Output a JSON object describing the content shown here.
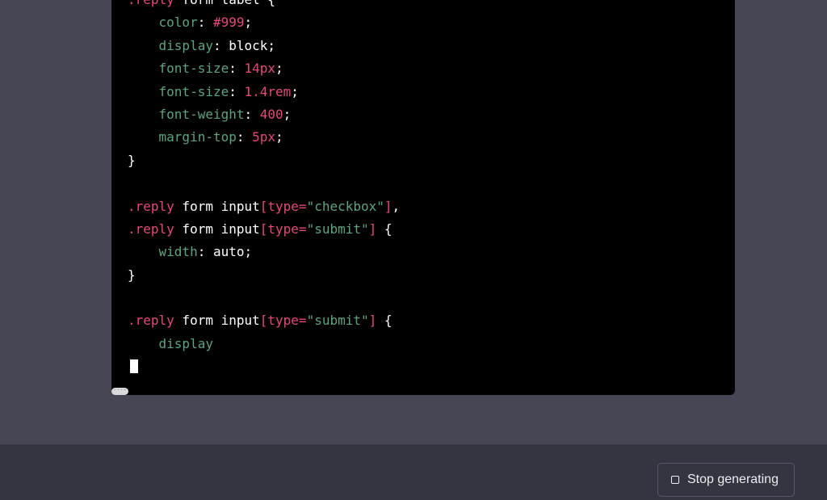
{
  "code": {
    "lines": [
      [
        {
          "t": ".reply",
          "c": "sel"
        },
        {
          "t": " form ",
          "c": "plain"
        },
        {
          "t": "label",
          "c": "plain"
        },
        {
          "t": " {",
          "c": "plain"
        }
      ],
      [
        {
          "t": "    ",
          "c": "plain"
        },
        {
          "t": "color",
          "c": "prop"
        },
        {
          "t": ": ",
          "c": "plain"
        },
        {
          "t": "#999",
          "c": "num"
        },
        {
          "t": ";",
          "c": "plain"
        }
      ],
      [
        {
          "t": "    ",
          "c": "plain"
        },
        {
          "t": "display",
          "c": "prop"
        },
        {
          "t": ": block;",
          "c": "plain"
        }
      ],
      [
        {
          "t": "    ",
          "c": "plain"
        },
        {
          "t": "font-size",
          "c": "prop"
        },
        {
          "t": ": ",
          "c": "plain"
        },
        {
          "t": "14px",
          "c": "num"
        },
        {
          "t": ";",
          "c": "plain"
        }
      ],
      [
        {
          "t": "    ",
          "c": "plain"
        },
        {
          "t": "font-size",
          "c": "prop"
        },
        {
          "t": ": ",
          "c": "plain"
        },
        {
          "t": "1.4rem",
          "c": "num"
        },
        {
          "t": ";",
          "c": "plain"
        }
      ],
      [
        {
          "t": "    ",
          "c": "plain"
        },
        {
          "t": "font-weight",
          "c": "prop"
        },
        {
          "t": ": ",
          "c": "plain"
        },
        {
          "t": "400",
          "c": "num"
        },
        {
          "t": ";",
          "c": "plain"
        }
      ],
      [
        {
          "t": "    ",
          "c": "plain"
        },
        {
          "t": "margin-top",
          "c": "prop"
        },
        {
          "t": ": ",
          "c": "plain"
        },
        {
          "t": "5px",
          "c": "num"
        },
        {
          "t": ";",
          "c": "plain"
        }
      ],
      [
        {
          "t": "}",
          "c": "plain"
        }
      ],
      [],
      [
        {
          "t": ".reply",
          "c": "sel"
        },
        {
          "t": " form input",
          "c": "plain"
        },
        {
          "t": "[type=",
          "c": "sel"
        },
        {
          "t": "\"checkbox\"",
          "c": "str"
        },
        {
          "t": "]",
          "c": "sel"
        },
        {
          "t": ",",
          "c": "plain"
        }
      ],
      [
        {
          "t": ".reply",
          "c": "sel"
        },
        {
          "t": " form input",
          "c": "plain"
        },
        {
          "t": "[type=",
          "c": "sel"
        },
        {
          "t": "\"submit\"",
          "c": "str"
        },
        {
          "t": "]",
          "c": "sel"
        },
        {
          "t": " {",
          "c": "plain"
        }
      ],
      [
        {
          "t": "    ",
          "c": "plain"
        },
        {
          "t": "width",
          "c": "prop"
        },
        {
          "t": ": auto;",
          "c": "plain"
        }
      ],
      [
        {
          "t": "}",
          "c": "plain"
        }
      ],
      [],
      [
        {
          "t": ".reply",
          "c": "sel"
        },
        {
          "t": " form input",
          "c": "plain"
        },
        {
          "t": "[type=",
          "c": "sel"
        },
        {
          "t": "\"submit\"",
          "c": "str"
        },
        {
          "t": "]",
          "c": "sel"
        },
        {
          "t": " {",
          "c": "plain"
        }
      ],
      [
        {
          "t": "    ",
          "c": "plain"
        },
        {
          "t": "display",
          "c": "prop"
        }
      ]
    ]
  },
  "scroll_handle": {
    "label": "····"
  },
  "stop_button": {
    "label": "Stop generating"
  },
  "colors": {
    "chat_bg": "#444654",
    "code_bg": "#000000",
    "property": "#5fa37f",
    "value": "#e34a7a",
    "bottom_bar": "#343541"
  }
}
